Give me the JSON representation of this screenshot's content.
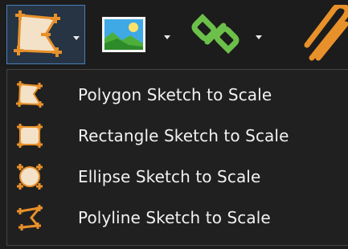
{
  "toolbar": {
    "tools": [
      {
        "name": "sketch-to-scale",
        "icon": "polygon-sketch-icon",
        "has_dropdown": true
      },
      {
        "name": "image",
        "icon": "picture-icon",
        "has_dropdown": true
      },
      {
        "name": "link",
        "icon": "chain-link-icon",
        "has_dropdown": true
      },
      {
        "name": "attach",
        "icon": "paperclip-icon",
        "has_dropdown": false
      }
    ]
  },
  "menu": {
    "items": [
      {
        "label": "Polygon Sketch to Scale",
        "icon": "polygon-sketch-icon"
      },
      {
        "label": "Rectangle Sketch to Scale",
        "icon": "rectangle-sketch-icon"
      },
      {
        "label": "Ellipse Sketch to Scale",
        "icon": "ellipse-sketch-icon"
      },
      {
        "label": "Polyline Sketch to Scale",
        "icon": "polyline-sketch-icon"
      }
    ]
  },
  "colors": {
    "background": "#1d1d1d",
    "selected_tool_border": "#4a7fb8",
    "icon_orange": "#e8902a",
    "icon_fill": "#f3e2c7",
    "link_green": "#6cc04a",
    "text": "#f2f2f2"
  }
}
